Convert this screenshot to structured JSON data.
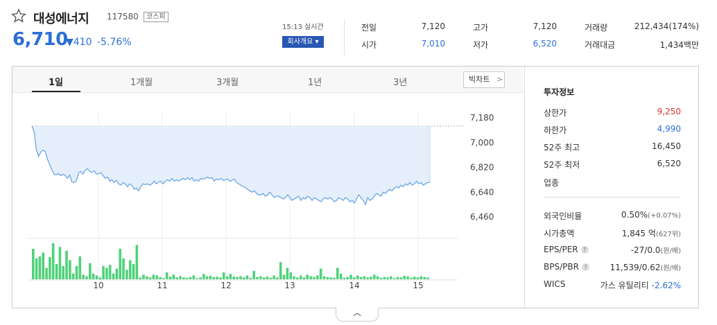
{
  "stock": {
    "name": "대성에너지",
    "code": "117580",
    "market": "코스피",
    "price": "6,710",
    "change": "▼410",
    "rate": "-5.76%",
    "time": "15:13 실시간",
    "overview_label": "회사개요 ▾"
  },
  "stats": [
    {
      "label": "전일",
      "value": "7,120"
    },
    {
      "label": "시가",
      "value": "7,010"
    },
    {
      "label": "고가",
      "value": "7,120"
    },
    {
      "label": "저가",
      "value": "6,520"
    },
    {
      "label": "거래량",
      "value": "212,434(174%)"
    },
    {
      "label": "거래대금",
      "value": "1,434백만"
    }
  ],
  "tabs": [
    "1일",
    "1개월",
    "3개월",
    "1년",
    "3년"
  ],
  "bigchart_label": "빅차트",
  "side": {
    "title": "투자정보",
    "rows1": [
      {
        "label": "상한가",
        "value": "9,250"
      },
      {
        "label": "하한가",
        "value": "4,990"
      },
      {
        "label": "52주 최고",
        "value": "16,450"
      },
      {
        "label": "52주 최저",
        "value": "6,520"
      },
      {
        "label": "업종",
        "value": ""
      }
    ],
    "rows2": [
      {
        "label": "외국인비율",
        "value": "0.50%",
        "sub": "(+0.07%)"
      },
      {
        "label": "시가총액",
        "value": "1,845 억",
        "sub": "(627위)"
      },
      {
        "label": "EPS/PER",
        "value": "-27/0.0",
        "sub": "(원/배)"
      },
      {
        "label": "BPS/PBR",
        "value": "11,539/0.62",
        "sub": "(원/배)"
      },
      {
        "label": "WICS",
        "value": "가스 유틸리티",
        "sub": "-2.62%"
      }
    ]
  },
  "colors": {
    "up": "#e0322a",
    "down": "#2c6fd6",
    "volume": "#4fd17a",
    "line": "#6ca6e6"
  },
  "chart_data": {
    "type": "line",
    "y_ticks": [
      "7,180",
      "7,000",
      "6,820",
      "6,640",
      "6,460"
    ],
    "x_ticks": [
      "10",
      "11",
      "12",
      "13",
      "14",
      "15"
    ],
    "ylim": [
      6460,
      7180
    ],
    "prev_close": 7120,
    "price_series": [
      7120,
      7080,
      6950,
      6900,
      6930,
      6945,
      6935,
      6880,
      6840,
      6800,
      6770,
      6765,
      6775,
      6760,
      6770,
      6760,
      6740,
      6765,
      6715,
      6710,
      6720,
      6780,
      6790,
      6770,
      6800,
      6810,
      6790,
      6785,
      6795,
      6770,
      6775,
      6780,
      6760,
      6740,
      6750,
      6720,
      6730,
      6710,
      6725,
      6700,
      6690,
      6710,
      6700,
      6680,
      6700,
      6690,
      6660,
      6670,
      6650,
      6680,
      6700,
      6695,
      6700,
      6690,
      6700,
      6720,
      6700,
      6715,
      6720,
      6700,
      6720,
      6730,
      6720,
      6740,
      6720,
      6730,
      6720,
      6730,
      6740,
      6730,
      6745,
      6730,
      6745,
      6720,
      6730,
      6720,
      6740,
      6735,
      6740,
      6750,
      6740,
      6745,
      6720,
      6735,
      6730,
      6740,
      6725,
      6730,
      6735,
      6720,
      6725,
      6735,
      6710,
      6700,
      6690,
      6680,
      6675,
      6660,
      6650,
      6640,
      6650,
      6630,
      6620,
      6620,
      6630,
      6610,
      6620,
      6640,
      6620,
      6600,
      6610,
      6610,
      6600,
      6590,
      6600,
      6620,
      6600,
      6580,
      6590,
      6600,
      6610,
      6580,
      6600,
      6590,
      6610,
      6600,
      6580,
      6600,
      6590,
      6580,
      6570,
      6590,
      6600,
      6590,
      6600,
      6590,
      6570,
      6580,
      6600,
      6590,
      6580,
      6600,
      6590,
      6570,
      6580,
      6560,
      6590,
      6620,
      6600,
      6580,
      6550,
      6600,
      6580,
      6590,
      6610,
      6630,
      6620,
      6610,
      6640,
      6630,
      6650,
      6660,
      6650,
      6670,
      6680,
      6670,
      6690,
      6680,
      6700,
      6690,
      6710,
      6690,
      6700,
      6720,
      6700,
      6710,
      6690,
      6700,
      6710,
      6710
    ],
    "volume_series": [
      80,
      55,
      60,
      70,
      30,
      58,
      95,
      40,
      85,
      35,
      75,
      50,
      15,
      35,
      60,
      12,
      8,
      42,
      15,
      10,
      5,
      35,
      30,
      38,
      15,
      28,
      80,
      55,
      25,
      50,
      40,
      90,
      5,
      12,
      8,
      5,
      12,
      10,
      6,
      3,
      18,
      7,
      12,
      5,
      8,
      5,
      4,
      6,
      10,
      3,
      5,
      14,
      8,
      9,
      6,
      7,
      5,
      18,
      8,
      14,
      7,
      6,
      8,
      5,
      10,
      4,
      22,
      6,
      8,
      5,
      7,
      4,
      10,
      5,
      45,
      12,
      30,
      18,
      8,
      5,
      10,
      5,
      12,
      8,
      6,
      10,
      28,
      8,
      6,
      5,
      4,
      30,
      15,
      4,
      6,
      12,
      5,
      10,
      6,
      8,
      5,
      7,
      12,
      8,
      4,
      6,
      5,
      8,
      3,
      6,
      5,
      9,
      8,
      4,
      7,
      5,
      8,
      6,
      5
    ],
    "volume_max": 100
  }
}
